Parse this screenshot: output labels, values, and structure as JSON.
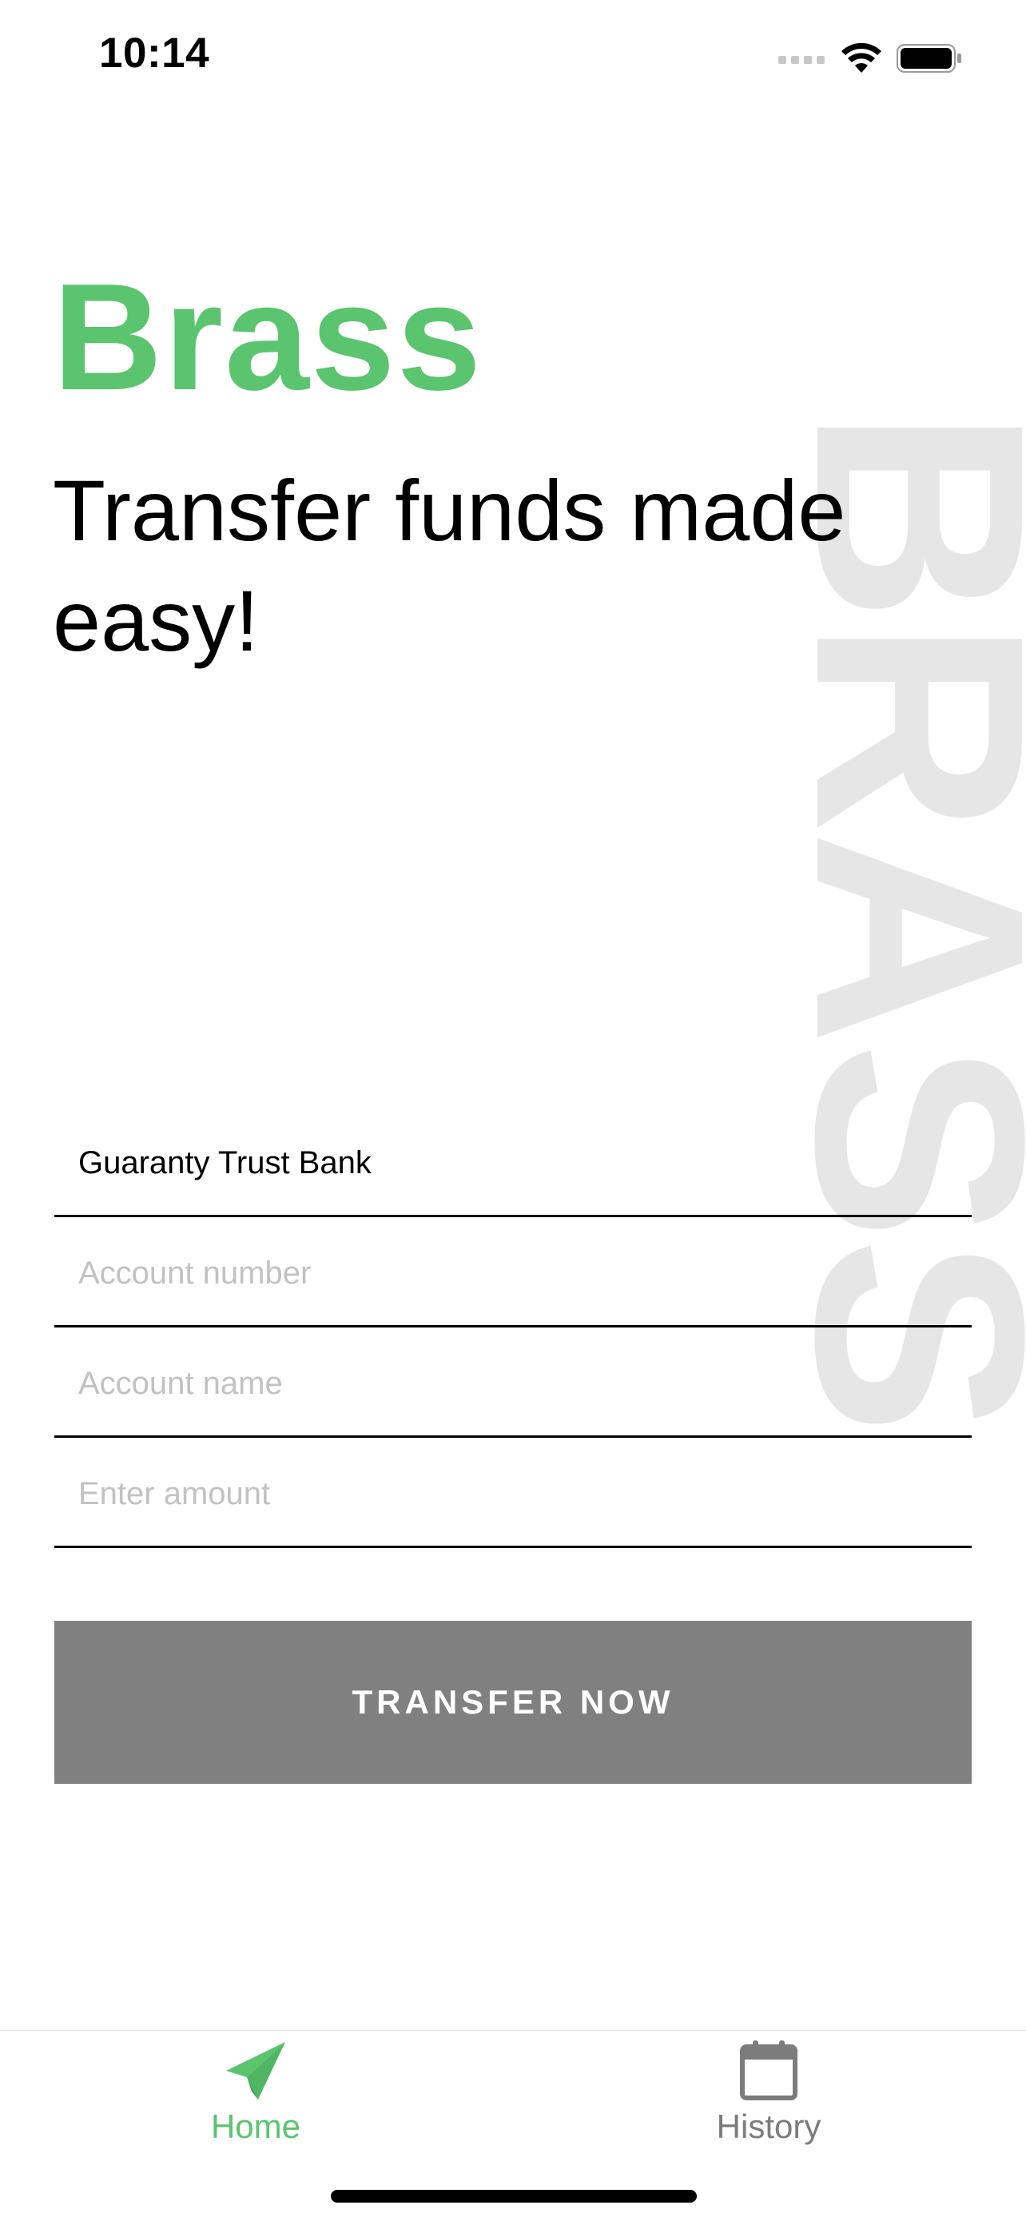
{
  "status_bar": {
    "time": "10:14"
  },
  "brand": {
    "title": "Brass",
    "tagline": "Transfer funds made easy!",
    "watermark": "BRASS",
    "accent_color": "#5ac46f"
  },
  "form": {
    "bank": {
      "value": "Guaranty Trust Bank"
    },
    "account_number": {
      "value": "",
      "placeholder": "Account number"
    },
    "account_name": {
      "value": "",
      "placeholder": "Account name"
    },
    "amount": {
      "value": "",
      "placeholder": "Enter amount"
    },
    "submit_label": "TRANSFER NOW"
  },
  "tab_bar": {
    "items": [
      {
        "label": "Home",
        "icon": "paper-plane-icon",
        "active": true
      },
      {
        "label": "History",
        "icon": "calendar-icon",
        "active": false
      }
    ]
  }
}
